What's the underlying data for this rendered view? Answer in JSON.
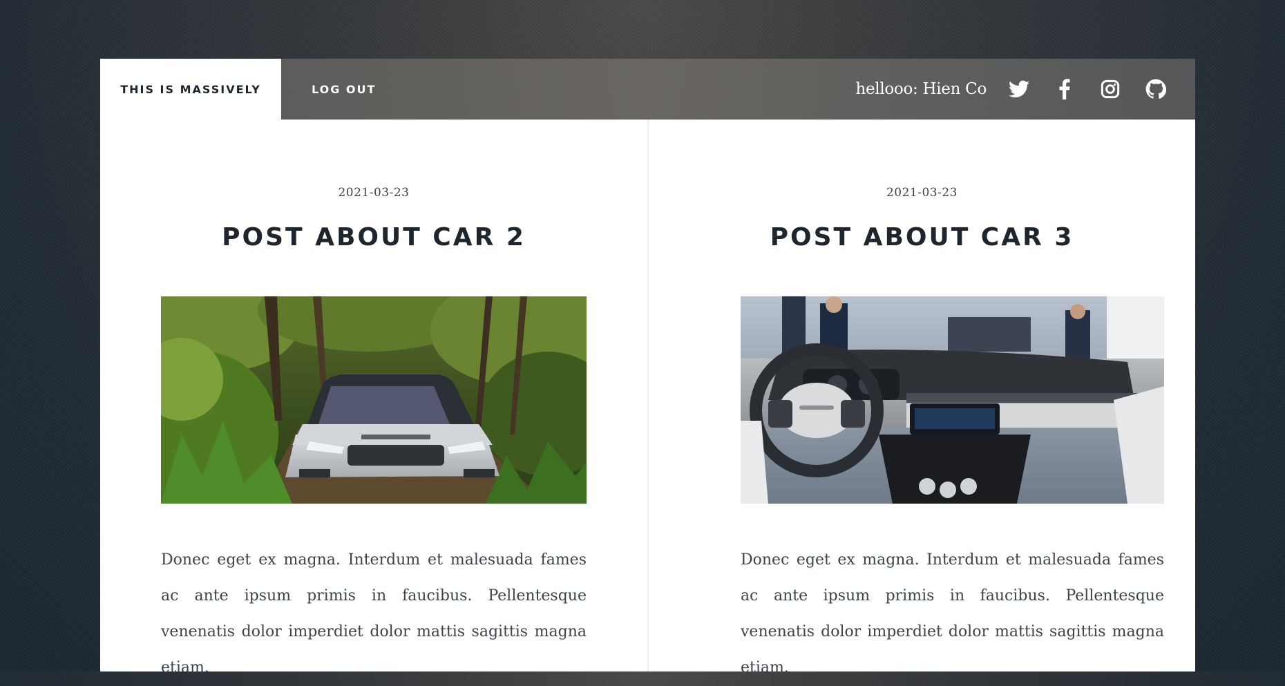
{
  "nav": {
    "logo": "THIS IS MASSIVELY",
    "logout": "LOG OUT",
    "greeting": "hellooo: Hien Co",
    "social_icons": [
      "twitter-icon",
      "facebook-icon",
      "instagram-icon",
      "github-icon"
    ]
  },
  "posts": [
    {
      "date": "2021-03-23",
      "title": "POST ABOUT CAR 2",
      "image": "white range rover suv driving through forest",
      "excerpt": "Donec eget ex magna. Interdum et malesuada fames ac ante ipsum primis in faucibus. Pellentesque venenatis dolor imperdiet dolor mattis sagittis magna etiam."
    },
    {
      "date": "2021-03-23",
      "title": "POST ABOUT CAR 3",
      "image": "car interior dashboard and steering wheel at auto show",
      "excerpt": "Donec eget ex magna. Interdum et malesuada fames ac ante ipsum primis in faucibus. Pellentesque venenatis dolor imperdiet dolor mattis sagittis magna etiam."
    }
  ],
  "colors": {
    "heading": "#1e252d",
    "body_text": "#3d4349",
    "nav_text": "#ffffff",
    "panel": "#ffffff"
  }
}
